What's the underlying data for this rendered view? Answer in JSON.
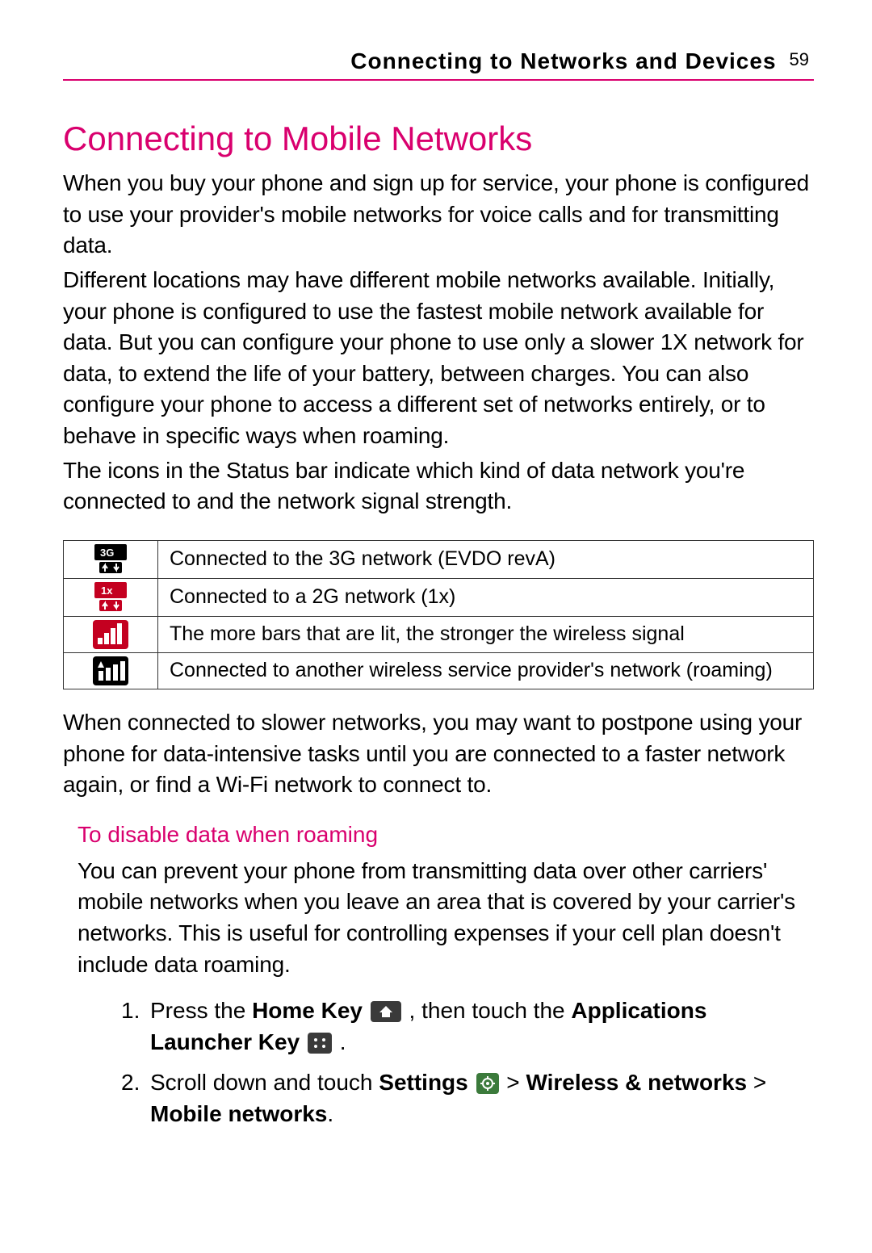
{
  "header": {
    "chapter_title": "Connecting to Networks and Devices",
    "page_number": "59"
  },
  "section": {
    "title": "Connecting to Mobile Networks",
    "para1": "When you buy your phone and sign up for service, your phone is configured to use your provider's mobile networks for voice calls and for transmitting data.",
    "para2": "Different locations may have different mobile networks available. Initially, your phone is configured to use the fastest mobile network available for data. But you can configure your phone to use only a slower 1X network for data, to extend the life of your battery, between charges. You can also configure your phone to access a different set of networks entirely, or to behave in specific ways when roaming.",
    "para3": "The icons in the Status bar indicate which kind of data network you're connected to and the network signal strength."
  },
  "icon_table": [
    {
      "icon": "3g-icon",
      "desc": "Connected to the 3G network (EVDO revA)"
    },
    {
      "icon": "1x-icon",
      "desc": "Connected to a 2G network (1x)"
    },
    {
      "icon": "signal-icon",
      "desc": "The more bars that are lit, the stronger the wireless signal"
    },
    {
      "icon": "roaming-icon",
      "desc": "Connected to another wireless service provider's network (roaming)"
    }
  ],
  "after_table": "When connected to slower networks, you may want to postpone using your phone for data-intensive tasks until you are connected to a faster network again, or find a Wi-Fi network to connect to.",
  "subsection": {
    "title": "To disable data when roaming",
    "para": "You can prevent your phone from transmitting data over other carriers' mobile networks when you leave an area that is covered by your carrier's networks. This is useful for controlling expenses if your cell plan doesn't include data roaming.",
    "steps": {
      "s1a": "Press the ",
      "s1b": "Home Key",
      "s1c": " , then touch the ",
      "s1d": "Applications Launcher Key",
      "s1e": " .",
      "s2a": "Scroll down and touch ",
      "s2b": "Settings",
      "s2c": "  > ",
      "s2d": "Wireless & networks",
      "s2e": " > ",
      "s2f": "Mobile networks",
      "s2g": "."
    }
  }
}
